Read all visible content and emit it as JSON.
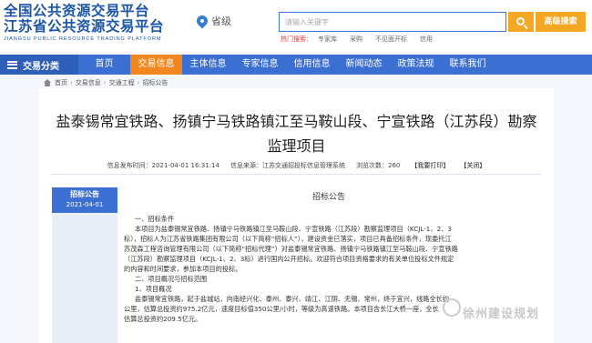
{
  "header": {
    "logo_cn_1": "全国公共资源交易平台",
    "logo_cn_2": "江苏省公共资源交易平台",
    "logo_en": "JIANGSU PUBLIC RESOURCE TRADING PLATFORM",
    "region": "省级",
    "search_placeholder": "请输入关键字",
    "advanced_search": "高级搜索",
    "hot_label": "热门搜索：",
    "hot_items": [
      "专家库",
      "采购",
      "不见面开标",
      "信用"
    ]
  },
  "nav": {
    "category": "交易分类",
    "items": [
      "首页",
      "交易信息",
      "主体信息",
      "专家信息",
      "信用信息",
      "新闻动态",
      "政策法规",
      "联系我们"
    ]
  },
  "breadcrumb": [
    "首页",
    "交易信息",
    "交通工程",
    "招标公告"
  ],
  "article": {
    "title": "盐泰锡常宜铁路、扬镇宁马铁路镇江至马鞍山段、宁宣铁路（江苏段）勘察监理项目",
    "publish_time": "信息发布时间：2021-04-01 16:31:14",
    "source": "信息来源：江苏交通招投标信息管理系统",
    "views": "浏览次数：260",
    "print": "【我要打印】",
    "close": "【关闭】",
    "badge_label": "招标公告",
    "badge_date": "2021-04-01",
    "doc_title": "招标公告",
    "lines": [
      "一、招标条件",
      "本项目为盐泰锡常宜铁路、扬镇宁马铁路镇江至马鞍山段、宁宣铁路（江苏段）勘察监理项目（KCJL-1、2、3",
      "标），招标人为江苏省铁路集团有限公司（以下简称“招标人”），建设资金已落实，项目已具备招标条件，现委托江",
      "苏茂森工程咨询管理有限公司（以下简称“招标代理”）对盐泰锡常宜铁路、扬镇宁马铁路镇江至马鞍山段、宁宣铁路",
      "（江苏段）勘察监理项目（KCJL-1、2、3标）进行国内公开招标。欢迎符合项目资格要求的有关单位投标文件规定",
      "的内容和时间要求，参加本项目的投标。",
      "二、项目概况与招标范围",
      "1、项目概况",
      "盐泰锡常宜铁路，起于盐城站，向南经兴化、泰州、泰兴、靖江、江阴、无锡、常州，终于宜兴，线路全长约",
      "公里，估算总投资约975.2亿元，速度目标值350公里/小时，等级为高速铁路。本项目含长江大桥一座，全长",
      "估算总投资约209.5亿元。"
    ],
    "watermark": "徐州建设规划"
  }
}
